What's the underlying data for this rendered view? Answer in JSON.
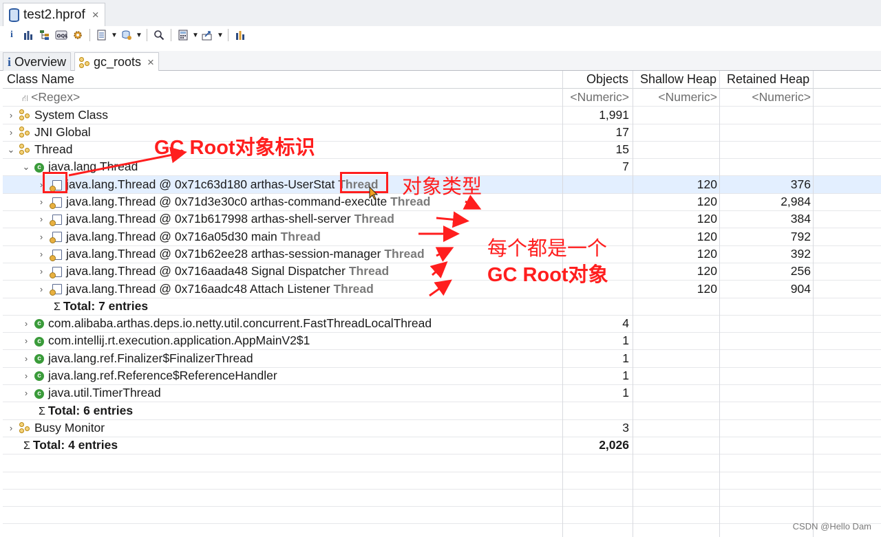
{
  "editor_tab": {
    "title": "test2.hprof",
    "close": "×"
  },
  "toolbar": {
    "buttons": [
      "info-icon",
      "histogram-icon",
      "dominator-tree-icon",
      "oql-icon",
      "gear-icon",
      "report-icon",
      "query-browser-icon",
      "search-icon",
      "calculator-icon",
      "export-icon",
      "heap-dump-icon"
    ]
  },
  "sub_tabs": [
    {
      "label": "Overview",
      "icon": "info-icon"
    },
    {
      "label": "gc_roots",
      "icon": "gc-root-icon",
      "close": "×"
    }
  ],
  "columns": {
    "class_name": "Class Name",
    "objects": "Objects",
    "shallow_heap": "Shallow Heap",
    "retained_heap": "Retained Heap"
  },
  "filter_row": {
    "class_name": "<Regex>",
    "objects": "<Numeric>",
    "shallow_heap": "<Numeric>",
    "retained_heap": "<Numeric>"
  },
  "rows": [
    {
      "name": "System Class",
      "objects": "1,991",
      "shallow": "",
      "retained": ""
    },
    {
      "name": "JNI Global",
      "objects": "17",
      "shallow": "",
      "retained": ""
    },
    {
      "name": "Thread",
      "objects": "15",
      "shallow": "",
      "retained": ""
    },
    {
      "name": "java.lang.Thread",
      "objects": "7",
      "shallow": "",
      "retained": ""
    },
    {
      "name": "java.lang.Thread @ 0x71c63d180  arthas-UserStat",
      "tag": "Thread",
      "objects": "",
      "shallow": "120",
      "retained": "376"
    },
    {
      "name": "java.lang.Thread @ 0x71d3e30c0  arthas-command-execute",
      "tag": "Thread",
      "objects": "",
      "shallow": "120",
      "retained": "2,984"
    },
    {
      "name": "java.lang.Thread @ 0x71b617998  arthas-shell-server",
      "tag": "Thread",
      "objects": "",
      "shallow": "120",
      "retained": "384"
    },
    {
      "name": "java.lang.Thread @ 0x716a05d30  main",
      "tag": "Thread",
      "objects": "",
      "shallow": "120",
      "retained": "792"
    },
    {
      "name": "java.lang.Thread @ 0x71b62ee28  arthas-session-manager",
      "tag": "Thread",
      "objects": "",
      "shallow": "120",
      "retained": "392"
    },
    {
      "name": "java.lang.Thread @ 0x716aada48  Signal Dispatcher",
      "tag": "Thread",
      "objects": "",
      "shallow": "120",
      "retained": "256"
    },
    {
      "name": "java.lang.Thread @ 0x716aadc48  Attach Listener",
      "tag": "Thread",
      "objects": "",
      "shallow": "120",
      "retained": "904"
    },
    {
      "name": "Total: 7 entries",
      "objects": "",
      "shallow": "",
      "retained": ""
    },
    {
      "name": "com.alibaba.arthas.deps.io.netty.util.concurrent.FastThreadLocalThread",
      "objects": "4",
      "shallow": "",
      "retained": ""
    },
    {
      "name": "com.intellij.rt.execution.application.AppMainV2$1",
      "objects": "1",
      "shallow": "",
      "retained": ""
    },
    {
      "name": "java.lang.ref.Finalizer$FinalizerThread",
      "objects": "1",
      "shallow": "",
      "retained": ""
    },
    {
      "name": "java.lang.ref.Reference$ReferenceHandler",
      "objects": "1",
      "shallow": "",
      "retained": ""
    },
    {
      "name": "java.util.TimerThread",
      "objects": "1",
      "shallow": "",
      "retained": ""
    },
    {
      "name": "Total: 6 entries",
      "objects": "",
      "shallow": "",
      "retained": ""
    },
    {
      "name": "Busy Monitor",
      "objects": "3",
      "shallow": "",
      "retained": ""
    },
    {
      "name": "Total: 4 entries",
      "objects": "2,026",
      "shallow": "",
      "retained": ""
    }
  ],
  "annotations": {
    "gc_root_label": "GC Root对象标识",
    "type_label": "对象类型",
    "each_line1": "每个都是一个",
    "each_line2": "GC Root对象",
    "color": "#ff1e1e"
  },
  "watermark": "CSDN @Hello Dam"
}
